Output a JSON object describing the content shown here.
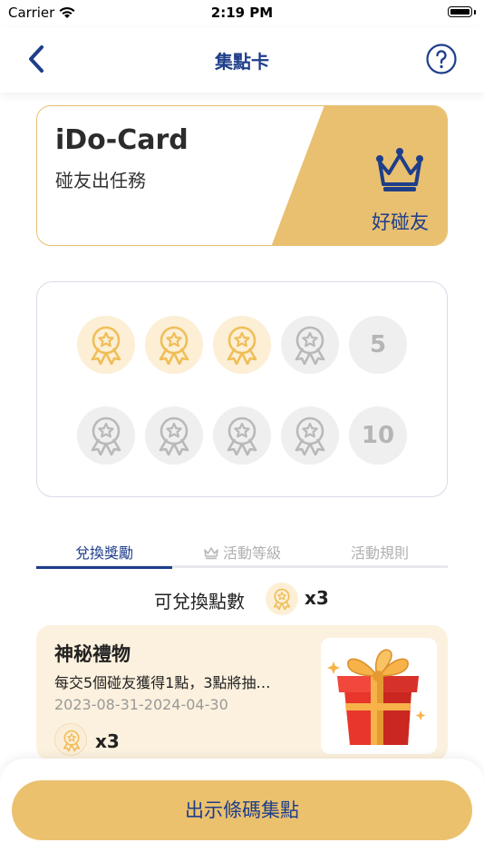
{
  "status_bar": {
    "carrier": "Carrier",
    "time": "2:19 PM"
  },
  "nav": {
    "title": "集點卡",
    "back_icon": "chevron-left-icon",
    "help_icon": "question-circle-icon"
  },
  "card": {
    "name": "iDo-Card",
    "subtitle": "碰友出任務",
    "tier": "好碰友",
    "icon": "crown-icon",
    "accent": "#e9c070"
  },
  "stamps": {
    "row1_count_label": "5",
    "row2_count_label": "10",
    "collected": 3,
    "total": 10
  },
  "tabs": [
    {
      "label": "兌換獎勵",
      "active": true
    },
    {
      "label": "活動等級",
      "active": false,
      "icon": "crown-icon"
    },
    {
      "label": "活動規則",
      "active": false
    }
  ],
  "points": {
    "label": "可兌換點數",
    "count": "x3"
  },
  "reward": {
    "title": "神秘禮物",
    "description": "每交5個碰友獲得1點，3點將抽…",
    "date_range": "2023-08-31-2024-04-30",
    "cost": "x3",
    "image": "gift-box-icon"
  },
  "cta": {
    "label": "出示條碼集點"
  },
  "colors": {
    "navy": "#1e3e8a",
    "gold": "#ebc16e",
    "cream": "#fcf1de"
  }
}
